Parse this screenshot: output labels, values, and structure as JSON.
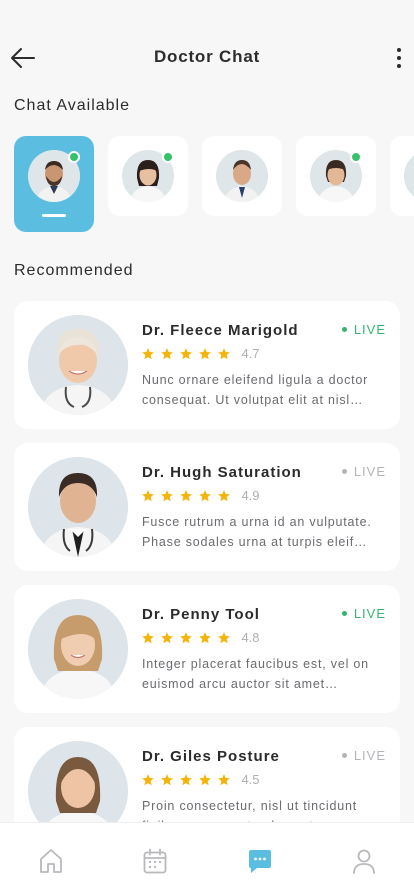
{
  "header": {
    "title": "Doctor Chat"
  },
  "sections": {
    "chat_available": "Chat Available",
    "recommended": "Recommended"
  },
  "chat_available": [
    {
      "online": true,
      "active": true
    },
    {
      "online": true,
      "active": false
    },
    {
      "online": false,
      "active": false
    },
    {
      "online": true,
      "active": false
    },
    {
      "online": false,
      "active": false
    }
  ],
  "doctors": [
    {
      "name": "Dr. Fleece Marigold",
      "status": "LIVE",
      "live": true,
      "rating": "4.7",
      "stars": 5,
      "desc": "Nunc ornare eleifend ligula a doctor consequat. Ut volutpat elit at nisl…"
    },
    {
      "name": "Dr. Hugh Saturation",
      "status": "LIVE",
      "live": false,
      "rating": "4.9",
      "stars": 5,
      "desc": "Fusce rutrum a urna id an vulputate. Phase sodales urna at turpis eleif…"
    },
    {
      "name": "Dr. Penny Tool",
      "status": "LIVE",
      "live": true,
      "rating": "4.8",
      "stars": 5,
      "desc": "Integer placerat faucibus est, vel on euismod arcu auctor sit amet…"
    },
    {
      "name": "Dr. Giles Posture",
      "status": "LIVE",
      "live": false,
      "rating": "4.5",
      "stars": 5,
      "desc": "Proin consectetur, nisl ut tincidunt finibus, purus ante elementum"
    }
  ],
  "colors": {
    "accent": "#5bbde0",
    "live": "#34b56f",
    "offline": "#b4b4b8",
    "star": "#f5b40a",
    "nav_active": "#5bbde0",
    "nav_inactive": "#b9b9bd"
  },
  "nav": [
    {
      "icon": "home-icon",
      "active": false
    },
    {
      "icon": "calendar-icon",
      "active": false
    },
    {
      "icon": "chat-icon",
      "active": true
    },
    {
      "icon": "profile-icon",
      "active": false
    }
  ]
}
